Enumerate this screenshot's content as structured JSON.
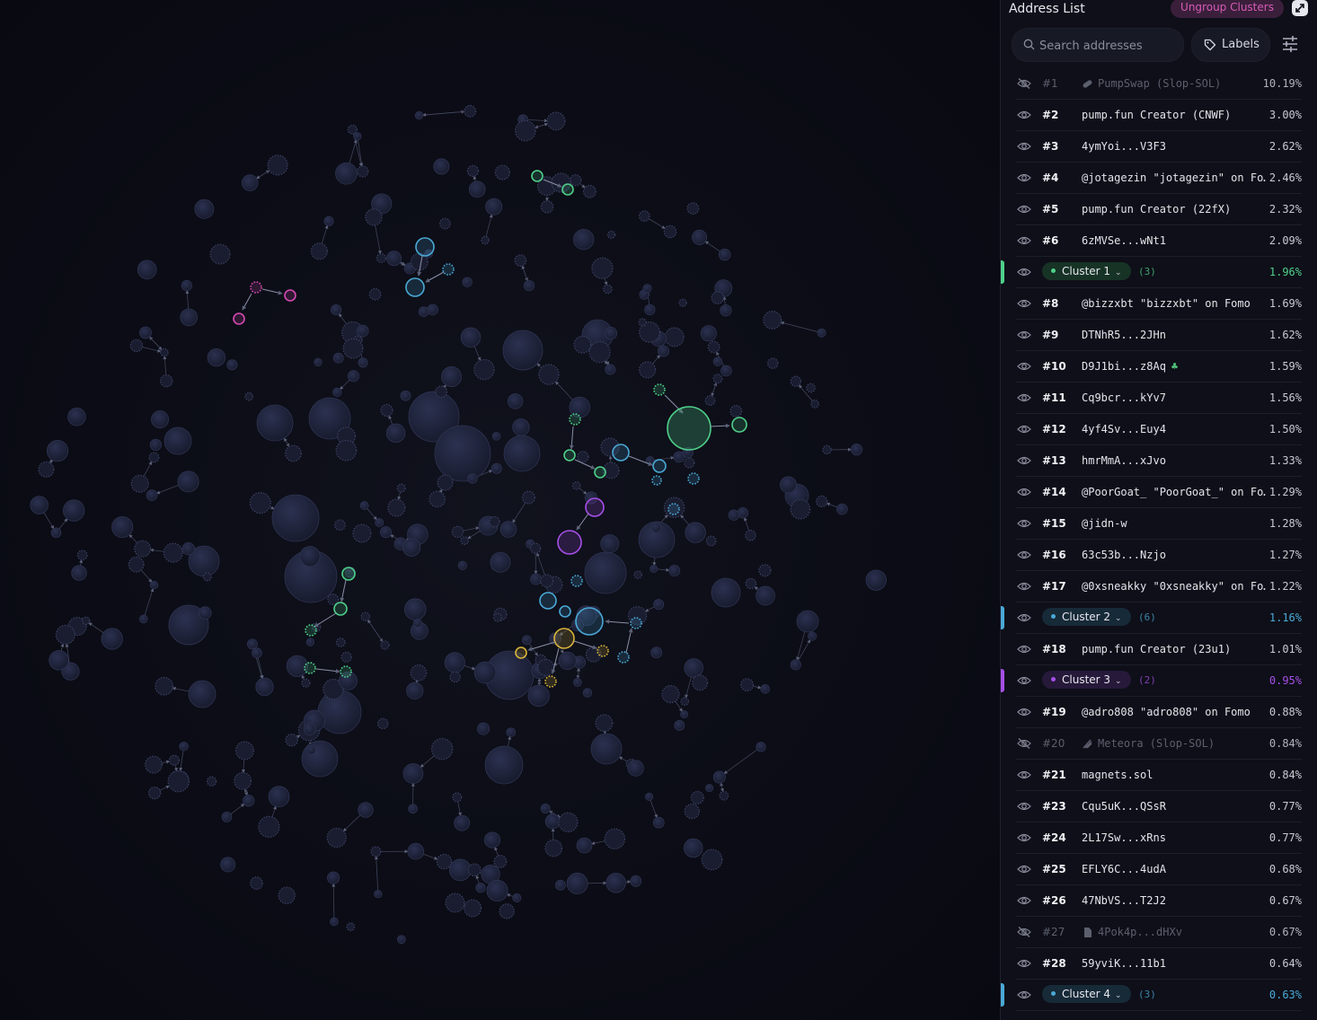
{
  "panel": {
    "title": "Address List",
    "ungroup_label": "Ungroup Clusters",
    "search_placeholder": "Search addresses",
    "labels_button": "Labels"
  },
  "colors": {
    "cluster1": "#4fd08a",
    "cluster2": "#4aa9d6",
    "cluster3": "#a64fe8",
    "cluster4": "#4aa9d6",
    "magenta": "#d64ab3",
    "gold": "#d8b43a",
    "node_default": "#2a2f4a"
  },
  "rows": [
    {
      "type": "address",
      "rank": "#1",
      "name": "PumpSwap (Slop-SOL)",
      "pct": "10.19%",
      "hidden": true,
      "icon": "pill-icon"
    },
    {
      "type": "address",
      "rank": "#2",
      "name": "pump.fun Creator (CNWF)",
      "pct": "3.00%"
    },
    {
      "type": "address",
      "rank": "#3",
      "name": "4ymYoi...V3F3",
      "pct": "2.62%"
    },
    {
      "type": "address",
      "rank": "#4",
      "name": "@jotagezin \"jotagezin\" on Fo…",
      "pct": "2.46%"
    },
    {
      "type": "address",
      "rank": "#5",
      "name": "pump.fun Creator (22fX)",
      "pct": "2.32%"
    },
    {
      "type": "address",
      "rank": "#6",
      "name": "6zMVSe...wNt1",
      "pct": "2.09%"
    },
    {
      "type": "cluster",
      "label": "Cluster 1",
      "count": "(3)",
      "pct": "1.96%",
      "color": "#4fd08a",
      "chip_bg": "#173326"
    },
    {
      "type": "address",
      "rank": "#8",
      "name": "@bizzxbt \"bizzxbt\" on Fomo",
      "pct": "1.69%"
    },
    {
      "type": "address",
      "rank": "#9",
      "name": "DTNhR5...2JHn",
      "pct": "1.62%"
    },
    {
      "type": "address",
      "rank": "#10",
      "name": "D9J1bi...z8Aq",
      "pct": "1.59%",
      "sprout": true
    },
    {
      "type": "address",
      "rank": "#11",
      "name": "Cq9bcr...kYv7",
      "pct": "1.56%"
    },
    {
      "type": "address",
      "rank": "#12",
      "name": "4yf4Sv...Euy4",
      "pct": "1.50%"
    },
    {
      "type": "address",
      "rank": "#13",
      "name": "hmrMmA...xJvo",
      "pct": "1.33%"
    },
    {
      "type": "address",
      "rank": "#14",
      "name": "@PoorGoat_ \"PoorGoat_\" on Fo…",
      "pct": "1.29%"
    },
    {
      "type": "address",
      "rank": "#15",
      "name": "@jidn-w",
      "pct": "1.28%"
    },
    {
      "type": "address",
      "rank": "#16",
      "name": "63c53b...Nzjo",
      "pct": "1.27%"
    },
    {
      "type": "address",
      "rank": "#17",
      "name": "@0xsneakky \"0xsneakky\" on Fo…",
      "pct": "1.22%"
    },
    {
      "type": "cluster",
      "label": "Cluster 2",
      "count": "(6)",
      "pct": "1.16%",
      "color": "#4aa9d6",
      "chip_bg": "#172a38"
    },
    {
      "type": "address",
      "rank": "#18",
      "name": "pump.fun Creator (23u1)",
      "pct": "1.01%"
    },
    {
      "type": "cluster",
      "label": "Cluster 3",
      "count": "(2)",
      "pct": "0.95%",
      "color": "#a64fe8",
      "chip_bg": "#26193a"
    },
    {
      "type": "address",
      "rank": "#19",
      "name": "@adro808 \"adro808\" on Fomo",
      "pct": "0.88%"
    },
    {
      "type": "address",
      "rank": "#20",
      "name": "Meteora (Slop-SOL)",
      "pct": "0.84%",
      "hidden": true,
      "icon": "meteora-icon"
    },
    {
      "type": "address",
      "rank": "#21",
      "name": "magnets.sol",
      "pct": "0.84%"
    },
    {
      "type": "address",
      "rank": "#23",
      "name": "Cqu5uK...QSsR",
      "pct": "0.77%"
    },
    {
      "type": "address",
      "rank": "#24",
      "name": "2L17Sw...xRns",
      "pct": "0.77%"
    },
    {
      "type": "address",
      "rank": "#25",
      "name": "EFLY6C...4udA",
      "pct": "0.68%"
    },
    {
      "type": "address",
      "rank": "#26",
      "name": "47NbVS...T2J2",
      "pct": "0.67%"
    },
    {
      "type": "address",
      "rank": "#27",
      "name": "4Pok4p...dHXv",
      "pct": "0.67%",
      "hidden": true,
      "icon": "document-icon"
    },
    {
      "type": "address",
      "rank": "#28",
      "name": "59yviK...11b1",
      "pct": "0.64%"
    },
    {
      "type": "cluster",
      "label": "Cluster 4",
      "count": "(3)",
      "pct": "0.63%",
      "color": "#4aa9d6",
      "chip_bg": "#172a38"
    }
  ]
}
